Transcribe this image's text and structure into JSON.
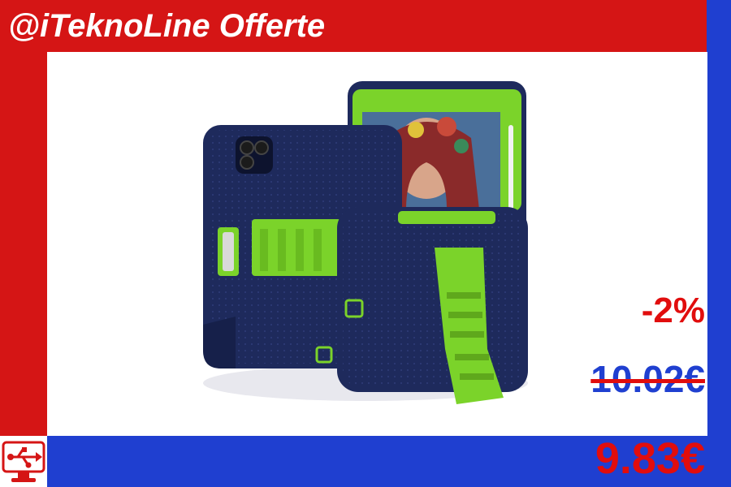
{
  "header": {
    "title": "@iTeknoLine Offerte"
  },
  "product": {
    "image_icon": "tablet-rugged-case-image",
    "colors": {
      "case_body": "#1e2a5c",
      "case_accent": "#7bd32a"
    }
  },
  "pricing": {
    "discount": "-2%",
    "old_price": "10.02€",
    "new_price": "9.83€"
  },
  "footer": {
    "logo_icon": "usb-monitor-icon"
  },
  "colors": {
    "brand_red": "#d51515",
    "brand_blue": "#1f3fd0",
    "price_red": "#e10d0d",
    "price_blue": "#1f3fd0"
  }
}
